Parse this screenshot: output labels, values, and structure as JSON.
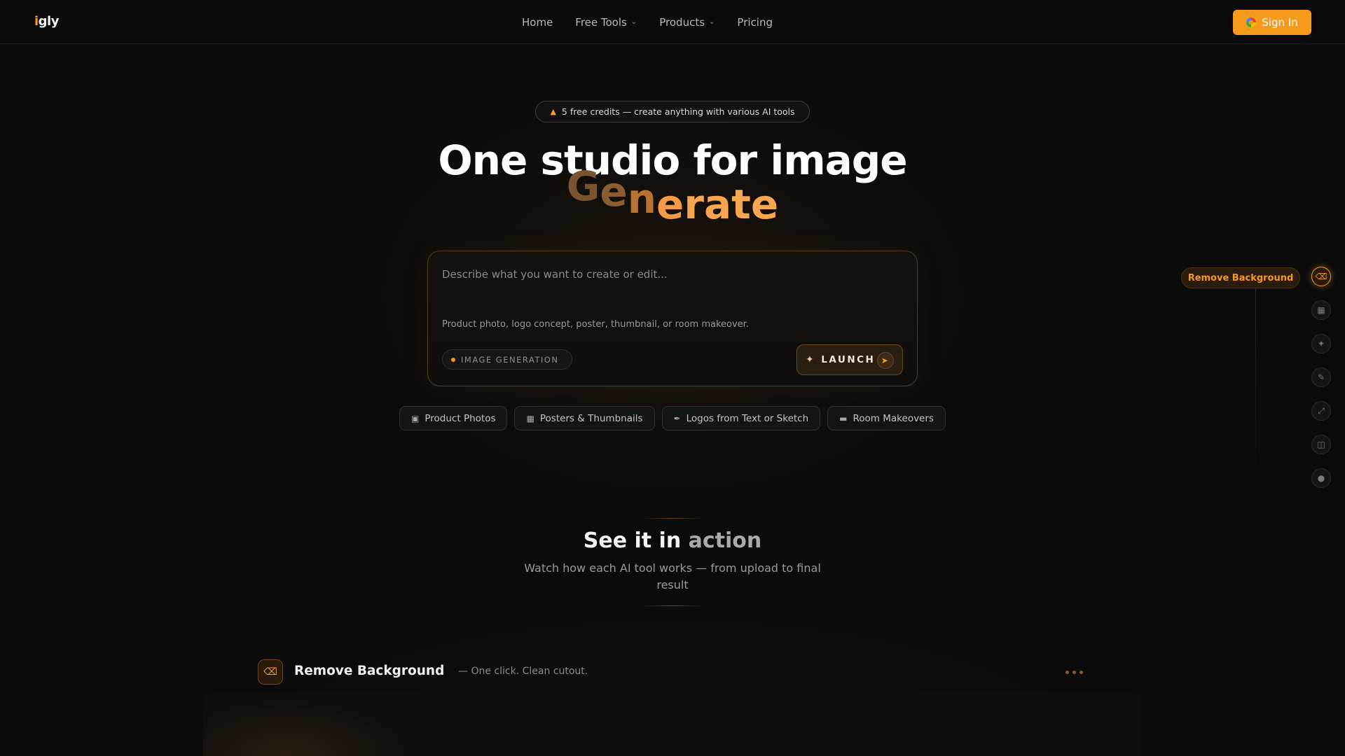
{
  "brand": {
    "logo_text": "gly",
    "logo_mark": "i"
  },
  "nav": {
    "items": [
      {
        "label": "Home",
        "has_dropdown": false
      },
      {
        "label": "Free Tools",
        "has_dropdown": true
      },
      {
        "label": "Products",
        "has_dropdown": true
      },
      {
        "label": "Pricing",
        "has_dropdown": false
      }
    ],
    "signin_label": "Sign In"
  },
  "badge": {
    "text": "5 free credits — create anything with various AI tools",
    "icon": "triangle-icon"
  },
  "hero": {
    "title": "One studio for image",
    "animated_word": "Generate"
  },
  "prompt": {
    "placeholder": "Describe what you want to create or edit...",
    "hint": "Product photo, logo concept, poster, thumbnail, or room makeover.",
    "mode_label": "IMAGE GENERATION",
    "launch_label": "LAUNCH"
  },
  "chips": [
    {
      "label": "Product Photos",
      "icon": "bag-icon"
    },
    {
      "label": "Posters & Thumbnails",
      "icon": "image-icon"
    },
    {
      "label": "Logos from Text or Sketch",
      "icon": "pen-tool-icon"
    },
    {
      "label": "Room Makeovers",
      "icon": "sofa-icon"
    }
  ],
  "tool_rail": {
    "active_tooltip": "Remove Background",
    "tools": [
      "eraser-icon",
      "image-edit-icon",
      "magic-wand-icon",
      "brush-icon",
      "expand-icon",
      "scan-icon",
      "dot-icon"
    ]
  },
  "section": {
    "title_main": "See it in ",
    "title_fade": "action",
    "subtitle": "Watch how each AI tool works — from upload to final result"
  },
  "demo": {
    "title": "Remove Background",
    "subtitle": "— One click. Clean cutout."
  },
  "colors": {
    "accent": "#f59a1b",
    "background": "#0b0b0b"
  }
}
